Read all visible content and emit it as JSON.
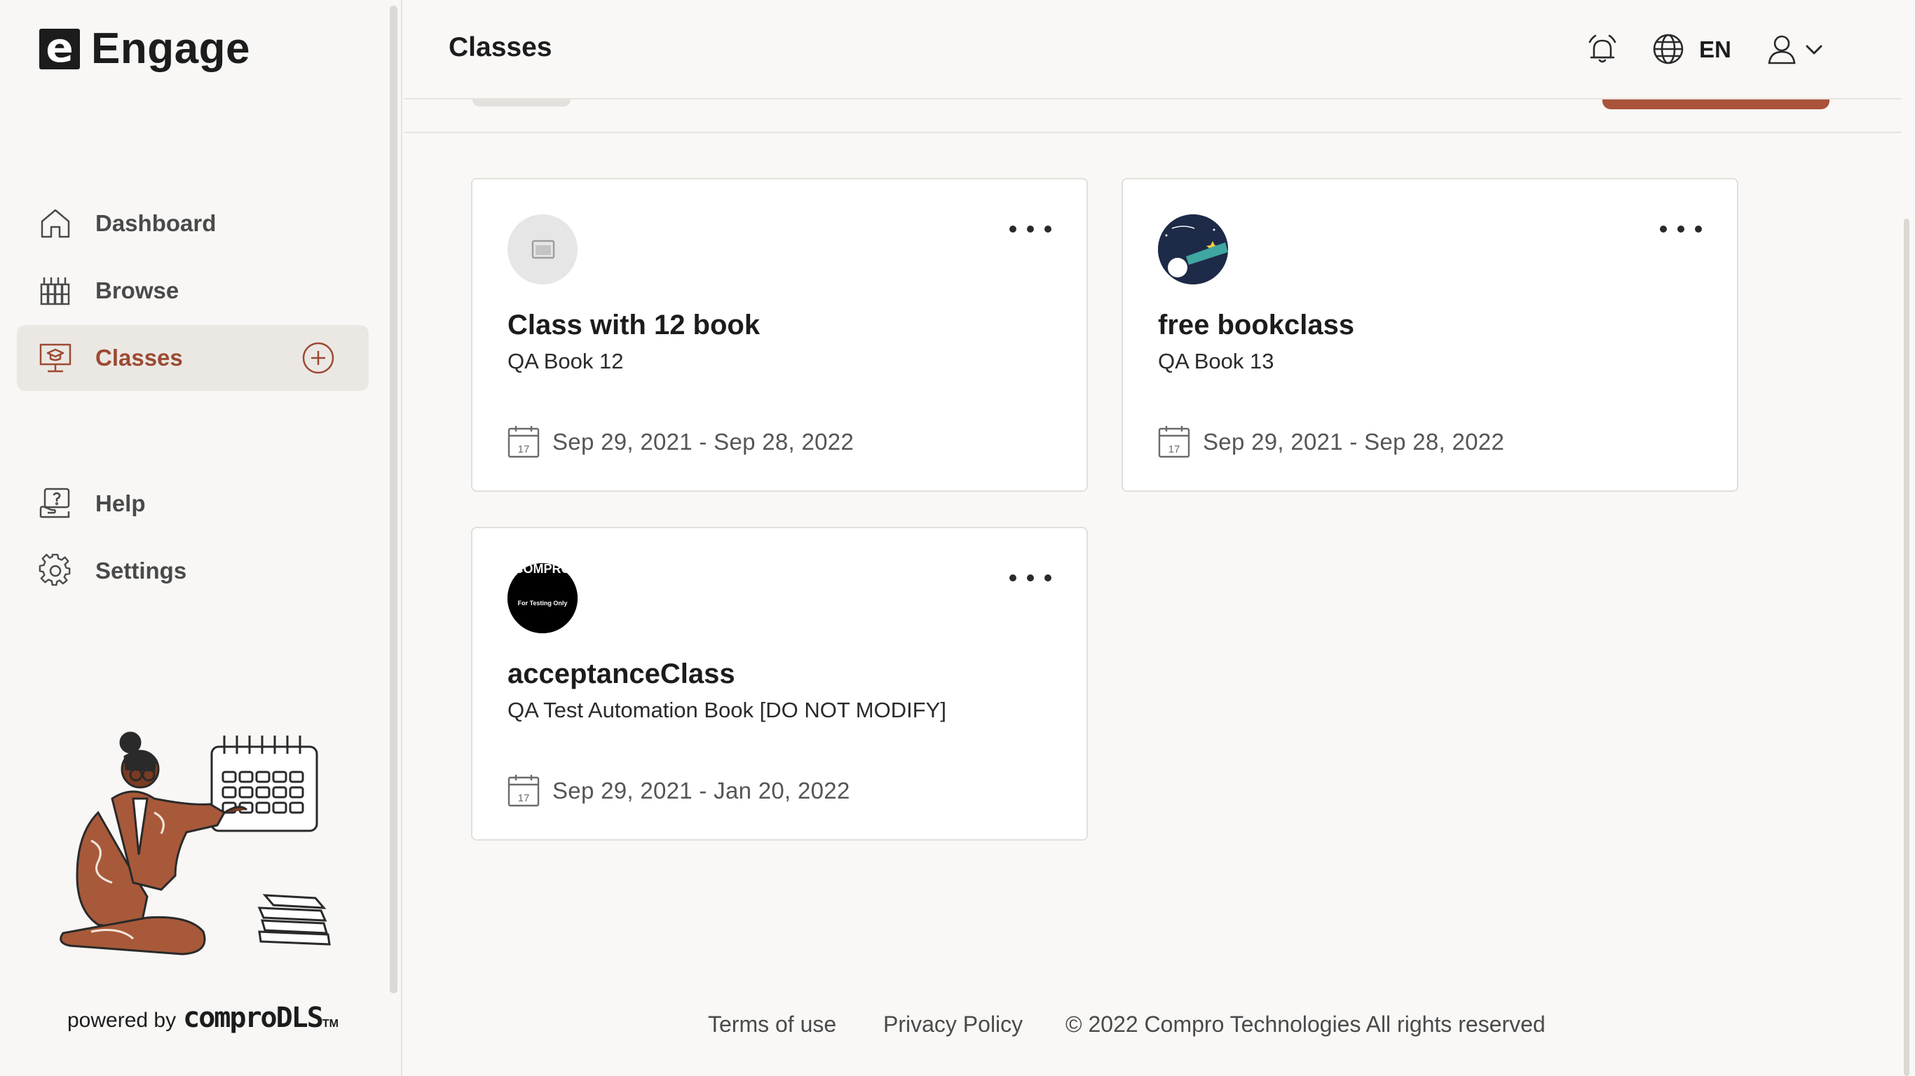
{
  "app": {
    "logo_letter": "e",
    "name": "Engage"
  },
  "sidebar": {
    "items": [
      {
        "label": "Dashboard",
        "icon": "home-icon"
      },
      {
        "label": "Browse",
        "icon": "library-icon"
      },
      {
        "label": "Classes",
        "icon": "classroom-icon",
        "active": true
      }
    ],
    "secondary": [
      {
        "label": "Help",
        "icon": "help-icon"
      },
      {
        "label": "Settings",
        "icon": "gear-icon"
      }
    ],
    "powered_prefix": "powered by",
    "powered_brand": "comproDLS",
    "powered_tm": "TM"
  },
  "header": {
    "title": "Classes",
    "language": "EN"
  },
  "classes": [
    {
      "title": "Class with 12 book",
      "book": "QA Book 12",
      "dates": "Sep 29, 2021 - Sep 28, 2022",
      "cal_day": "17"
    },
    {
      "title": "free bookclass",
      "book": "QA Book 13",
      "dates": "Sep 29, 2021 - Sep 28, 2022",
      "cal_day": "17"
    },
    {
      "title": "acceptanceClass",
      "book": "QA Test Automation Book [DO NOT MODIFY]",
      "dates": "Sep 29, 2021 - Jan 20, 2022",
      "cal_day": "17",
      "thumb_text": "For Testing Only",
      "thumb_banner": "COMPRO"
    }
  ],
  "footer": {
    "terms": "Terms of use",
    "privacy": "Privacy Policy",
    "copyright": "© 2022 Compro Technologies All rights reserved"
  },
  "colors": {
    "accent": "#9c4a33",
    "button": "#a9533a",
    "active_bg": "#ebe8e4"
  }
}
